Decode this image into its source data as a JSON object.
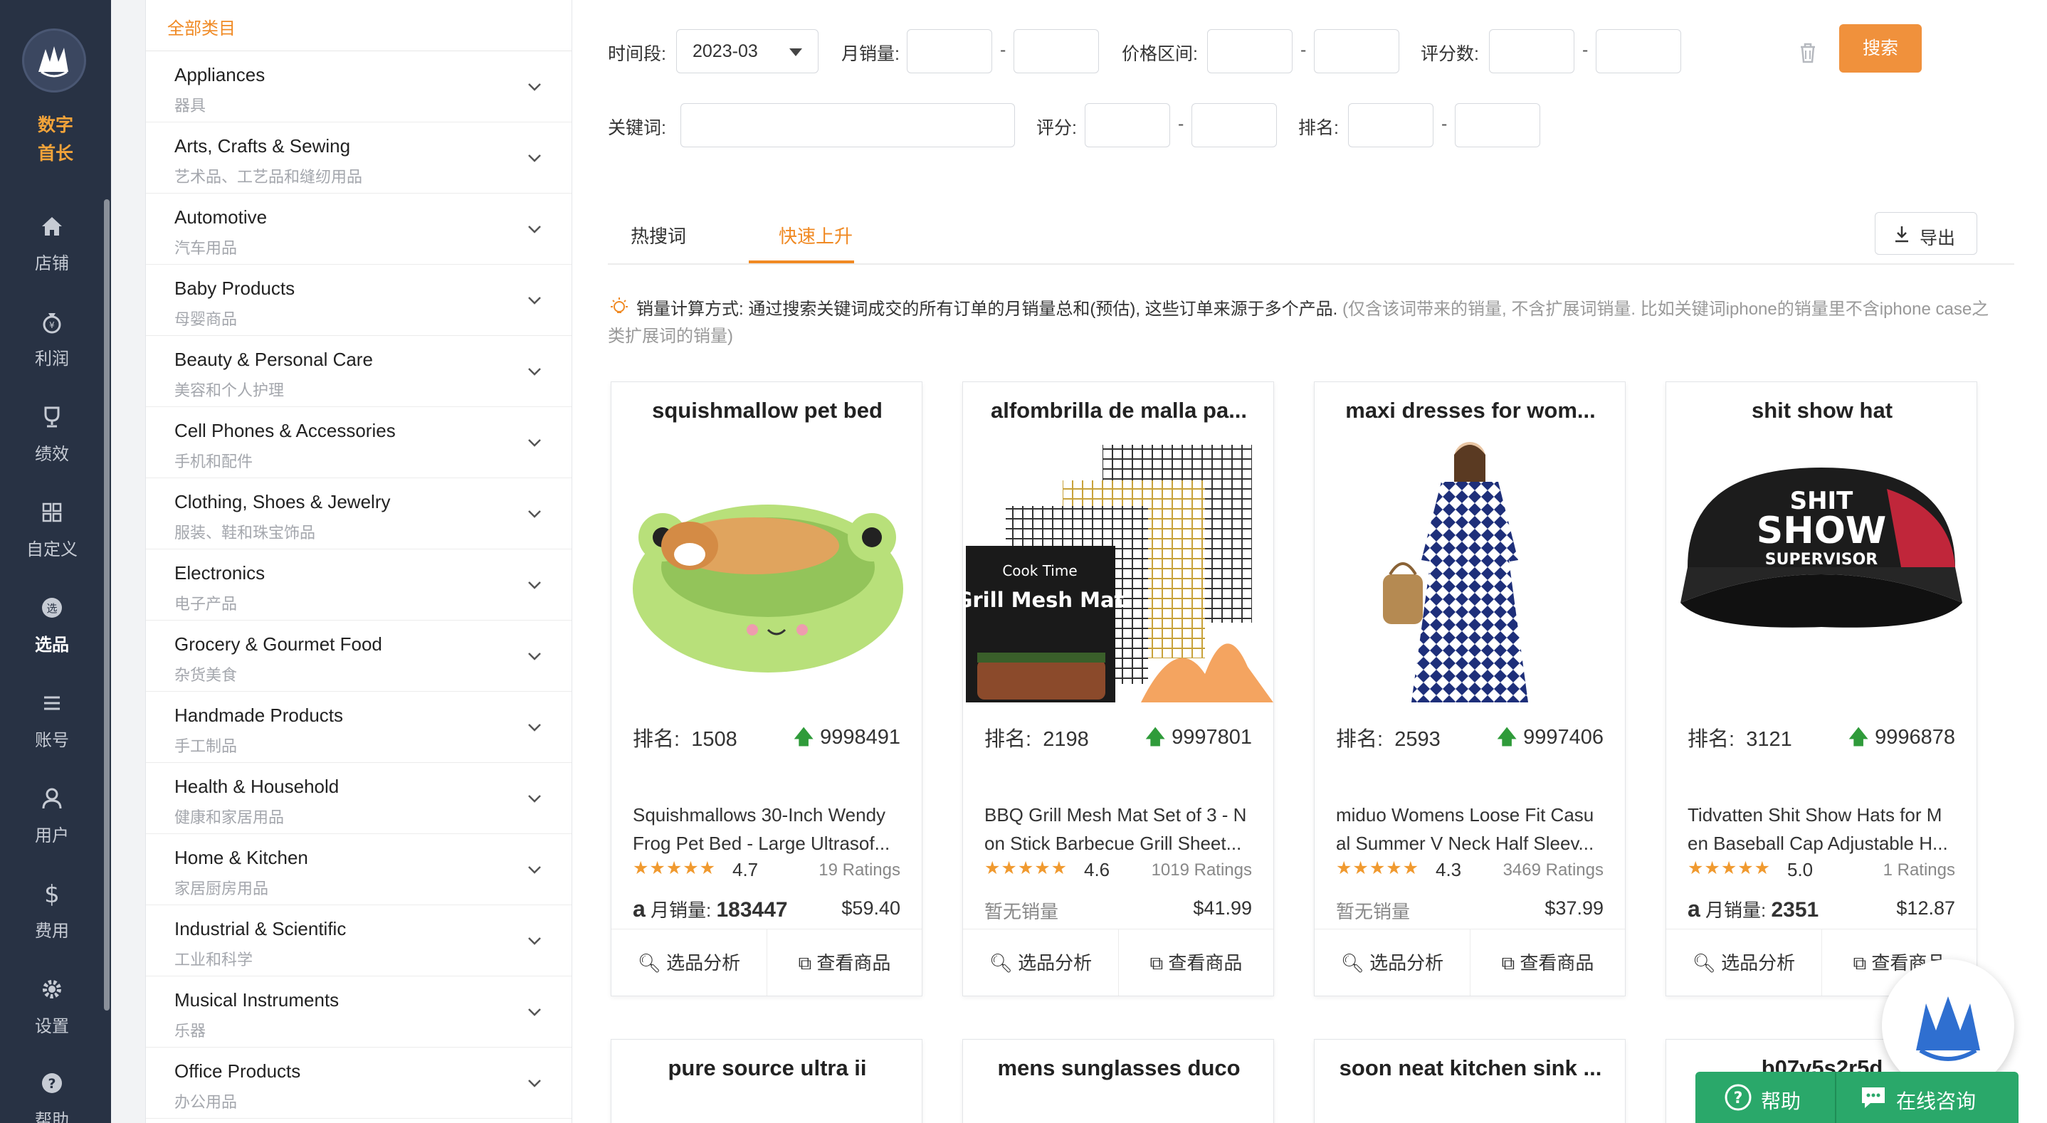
{
  "nav": {
    "brand_line1": "数字",
    "brand_line2": "首长",
    "items": [
      {
        "label": "店铺",
        "icon": "home-icon"
      },
      {
        "label": "利润",
        "icon": "money-bag-icon"
      },
      {
        "label": "绩效",
        "icon": "trophy-icon"
      },
      {
        "label": "自定义",
        "icon": "grid-icon"
      },
      {
        "label": "选品",
        "icon": "select-icon"
      },
      {
        "label": "账号",
        "icon": "list-icon"
      },
      {
        "label": "用户",
        "icon": "user-icon"
      },
      {
        "label": "费用",
        "icon": "dollar-icon"
      },
      {
        "label": "设置",
        "icon": "gear-icon"
      },
      {
        "label": "帮助",
        "icon": "help-icon"
      }
    ]
  },
  "categories": {
    "header": "全部类目",
    "items": [
      {
        "en": "Appliances",
        "cn": "器具"
      },
      {
        "en": "Arts, Crafts & Sewing",
        "cn": "艺术品、工艺品和缝纫用品"
      },
      {
        "en": "Automotive",
        "cn": "汽车用品"
      },
      {
        "en": "Baby Products",
        "cn": "母婴商品"
      },
      {
        "en": "Beauty & Personal Care",
        "cn": "美容和个人护理"
      },
      {
        "en": "Cell Phones & Accessories",
        "cn": "手机和配件"
      },
      {
        "en": "Clothing, Shoes & Jewelry",
        "cn": "服装、鞋和珠宝饰品"
      },
      {
        "en": "Electronics",
        "cn": "电子产品"
      },
      {
        "en": "Grocery & Gourmet Food",
        "cn": "杂货美食"
      },
      {
        "en": "Handmade Products",
        "cn": "手工制品"
      },
      {
        "en": "Health & Household",
        "cn": "健康和家居用品"
      },
      {
        "en": "Home & Kitchen",
        "cn": "家居厨房用品"
      },
      {
        "en": "Industrial & Scientific",
        "cn": "工业和科学"
      },
      {
        "en": "Musical Instruments",
        "cn": "乐器"
      },
      {
        "en": "Office Products",
        "cn": "办公用品"
      }
    ]
  },
  "filters": {
    "period_label": "时间段:",
    "period_value": "2023-03",
    "monthly_sales_label": "月销量:",
    "price_label": "价格区间:",
    "reviews_label": "评分数:",
    "keyword_label": "关键词:",
    "rating_label": "评分:",
    "rank_label": "排名:",
    "dash": "-",
    "search_button": "搜索"
  },
  "tabs": {
    "hot": "热搜词",
    "rising": "快速上升",
    "export": "导出"
  },
  "note": {
    "main": "销量计算方式: 通过搜索关键词成交的所有订单的月销量总和(预估), 这些订单来源于多个产品.",
    "extra": "(仅含该词带来的销量, 不含扩展词销量. 比如关键词iphone的销量里不含iphone case之类扩展词的销量)"
  },
  "card_labels": {
    "rank_prefix": "排名:",
    "analysis": "选品分析",
    "view": "查看商品",
    "monthly_sales": "月销量:",
    "no_sales": "暂无销量"
  },
  "cards": [
    {
      "keyword": "squishmallow pet bed",
      "rank": "1508",
      "growth": "9998491",
      "desc1": "Squishmallows 30-Inch Wendy",
      "desc2": "Frog Pet Bed - Large Ultrasof...",
      "stars": "★★★★★",
      "score": "4.7",
      "ratings": "19 Ratings",
      "sales": "183447",
      "price": "$59.40"
    },
    {
      "keyword": "alfombrilla de malla pa...",
      "rank": "2198",
      "growth": "9997801",
      "desc1": "BBQ Grill Mesh Mat Set of 3 - N",
      "desc2": "on Stick Barbecue Grill Sheet...",
      "stars": "★★★★★",
      "score": "4.6",
      "ratings": "1019 Ratings",
      "sales": "",
      "price": "$41.99"
    },
    {
      "keyword": "maxi dresses for wom...",
      "rank": "2593",
      "growth": "9997406",
      "desc1": "miduo Womens Loose Fit Casu",
      "desc2": "al Summer V Neck Half Sleev...",
      "stars": "★★★★★",
      "score": "4.3",
      "ratings": "3469 Ratings",
      "sales": "",
      "price": "$37.99"
    },
    {
      "keyword": "shit show hat",
      "rank": "3121",
      "growth": "9996878",
      "desc1": "Tidvatten Shit Show Hats for M",
      "desc2": "en Baseball Cap Adjustable H...",
      "stars": "★★★★★",
      "score": "5.0",
      "ratings": "1 Ratings",
      "sales": "2351",
      "price": "$12.87"
    },
    {
      "keyword": "pure source ultra ii"
    },
    {
      "keyword": "mens sunglasses duco"
    },
    {
      "keyword": "soon neat kitchen sink ..."
    },
    {
      "keyword": "b07v5s2r5d"
    }
  ],
  "images": {
    "grill_brand": "Cook Time",
    "grill_title": "Grill Mesh Mat",
    "hat_line1": "SHIT",
    "hat_line2": "SHOW",
    "hat_line3": "SUPERVISOR"
  },
  "help": {
    "help_label": "帮助",
    "chat_label": "在线咨询"
  }
}
